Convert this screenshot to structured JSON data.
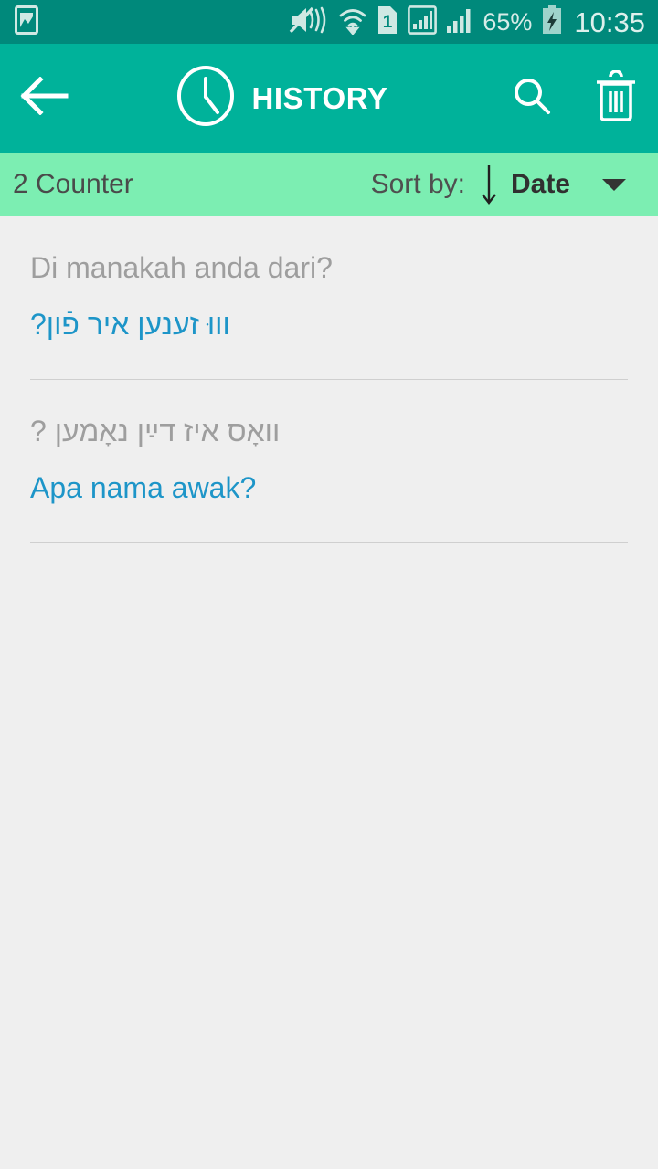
{
  "status_bar": {
    "background": "#00897b",
    "left_icons": [
      {
        "name": "photo-image-icon",
        "label": "image"
      }
    ],
    "right_icons": [
      {
        "name": "vibrate-mute-icon",
        "label": "silent-vibrate"
      },
      {
        "name": "wifi-icon",
        "label": "wifi"
      },
      {
        "name": "sim-card-1-icon",
        "label": "sim-1"
      },
      {
        "name": "signal-sim1-icon",
        "label": "signal-1"
      },
      {
        "name": "signal-sim2-icon",
        "label": "signal-2"
      }
    ],
    "battery_percent": "65%",
    "battery_state": "charging",
    "clock": "10:35"
  },
  "app_bar": {
    "background": "#00b29a",
    "back_icon": "arrow-left-icon",
    "clock_icon": "clock-icon",
    "title": "HISTORY",
    "search_icon": "search-icon",
    "delete_icon": "trash-icon"
  },
  "sort_bar": {
    "background": "#7ceeb2",
    "counter": "2 Counter",
    "sort_label": "Sort by:",
    "direction_icon": "arrow-down-icon",
    "sort_value": "Date",
    "caret_icon": "chevron-down-icon"
  },
  "history": {
    "items": [
      {
        "source_text": "Di manakah anda dari?",
        "source_dir": "ltr",
        "target_text": "וווּ זענען איר פֿון?",
        "target_dir": "rtl"
      },
      {
        "source_text": "וואָס איז דײַן נאָמען ?",
        "source_dir": "rtl",
        "target_text": "Apa nama awak?",
        "target_dir": "ltr"
      }
    ]
  },
  "colors": {
    "accent": "#00b29a",
    "status_bar": "#00897b",
    "sort_bar": "#7ceeb2",
    "translation_blue": "#1d95c8",
    "source_grey": "#9e9e9e",
    "page_background": "#efefef",
    "divider": "#cfcfcf"
  }
}
